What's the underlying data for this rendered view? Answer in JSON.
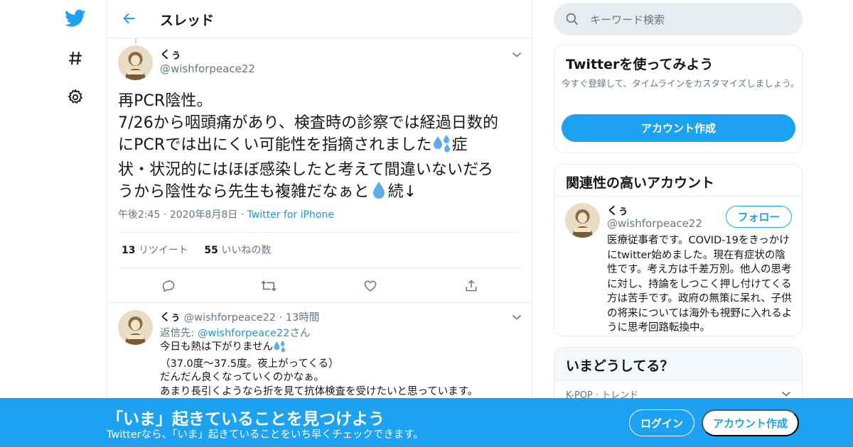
{
  "nav": {
    "icons": [
      "twitter-bird-icon",
      "hashtag-icon",
      "gear-icon"
    ]
  },
  "header": {
    "title": "スレッド"
  },
  "tweet": {
    "name": "くぅ",
    "handle": "@wishforpeace22",
    "text_line1": "再PCR陰性。",
    "text_line2": "7/26から咽頭痛があり、検査時の診察では経過日数的",
    "text_line3a": "にPCRでは出にくい可能性を指摘されました",
    "text_line3b": "症",
    "text_line4": "状・状況的にはほぼ感染したと考えて間違いないだろ",
    "text_line5a": "うから陰性なら先生も複雑だなぁと",
    "text_line5b": "続↓",
    "time": "午後2:45",
    "dot": "·",
    "date": "2020年8月8日",
    "source": "Twitter for iPhone",
    "retweets": "13",
    "retweets_label": "リツイート",
    "likes": "55",
    "likes_label": "いいねの数"
  },
  "reply": {
    "name": "くぅ",
    "handle": "@wishforpeace22",
    "dot": "·",
    "time": "13時間",
    "reply_to_label": "返信先: ",
    "reply_to_handle": "@wishforpeace22",
    "reply_to_suffix": "さん",
    "text_line1": "今日も熱は下がりません",
    "text_line2": "（37.0度〜37.5度。夜上がってくる）",
    "text_line3": "だんだん良くなっていくのかなぁ。",
    "text_line4": "あまり長引くようなら折を見て抗体検査を受けたいと思っています。"
  },
  "search": {
    "placeholder": "キーワード検索"
  },
  "signup_card": {
    "title": "Twitterを使ってみよう",
    "desc": "今すぐ登録して、タイムラインをカスタマイズしましょう。",
    "button": "アカウント作成"
  },
  "related": {
    "title": "関連性の高いアカウント",
    "name": "くぅ",
    "handle": "@wishforpeace22",
    "follow": "フォロー",
    "bio": "医療従事者です。COVID-19をきっかけにtwitter始めました。現在有症状の陰性です。考え方は千差万別。他人の思考に対し、持論をしつこく押し付けてくる方は苦手です。政府の無策に呆れ、子供の将来については海外も視野に入れるように思考回路転換中。"
  },
  "trends": {
    "title": "いまどうしてる？",
    "category": "K-POP · トレンド"
  },
  "banner": {
    "title": "「いま」起きていることを見つけよう",
    "subtitle": "Twitterなら、「いま」起きていることをいち早くチェックできます。",
    "login": "ログイン",
    "signup": "アカウント作成"
  },
  "colors": {
    "accent": "#1da1f2",
    "link": "#1b95e0",
    "muted": "#657786",
    "border": "#e6ecf0"
  }
}
